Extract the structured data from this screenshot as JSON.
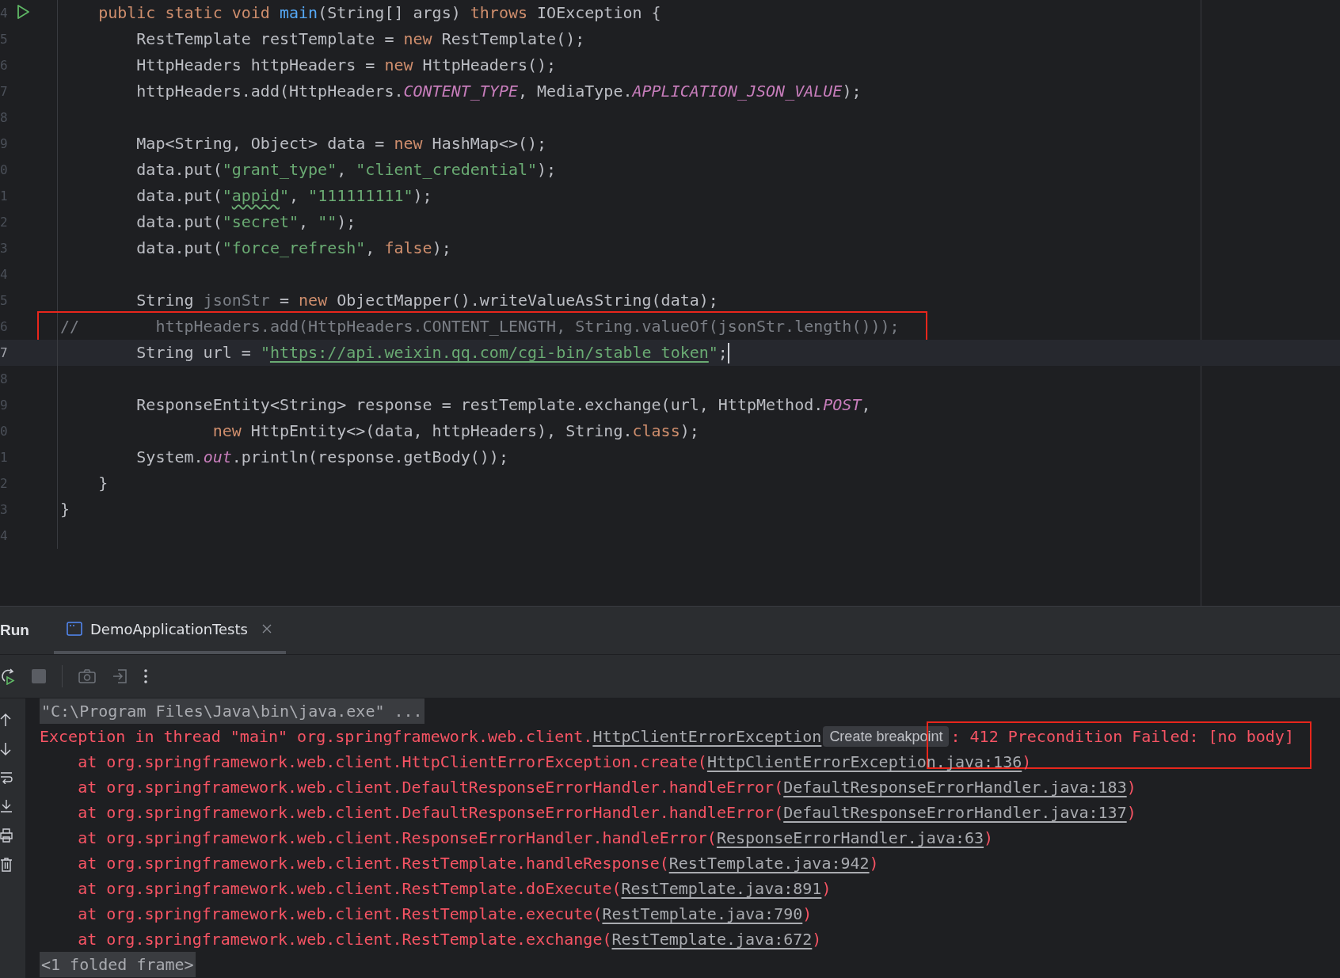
{
  "editor": {
    "lines": [
      {
        "number": "4",
        "run": true,
        "tokens": [
          {
            "text": "    public static void ",
            "kind": "keyword"
          },
          {
            "text": "main",
            "kind": "method"
          },
          {
            "text": "(String[] args) ",
            "kind": "plain"
          },
          {
            "text": "throws",
            "kind": "keyword"
          },
          {
            "text": " IOException {",
            "kind": "plain"
          }
        ]
      },
      {
        "number": "5",
        "tokens": [
          {
            "text": "        RestTemplate restTemplate = ",
            "kind": "plain"
          },
          {
            "text": "new",
            "kind": "keyword"
          },
          {
            "text": " RestTemplate();",
            "kind": "plain"
          }
        ]
      },
      {
        "number": "6",
        "tokens": [
          {
            "text": "        HttpHeaders httpHeaders = ",
            "kind": "plain"
          },
          {
            "text": "new",
            "kind": "keyword"
          },
          {
            "text": " HttpHeaders();",
            "kind": "plain"
          }
        ]
      },
      {
        "number": "7",
        "tokens": [
          {
            "text": "        httpHeaders.add(HttpHeaders.",
            "kind": "plain"
          },
          {
            "text": "CONTENT_TYPE",
            "kind": "field"
          },
          {
            "text": ", MediaType.",
            "kind": "plain"
          },
          {
            "text": "APPLICATION_JSON_VALUE",
            "kind": "field"
          },
          {
            "text": ");",
            "kind": "plain"
          }
        ]
      },
      {
        "number": "8"
      },
      {
        "number": "9",
        "tokens": [
          {
            "text": "        Map<String, Object> data = ",
            "kind": "plain"
          },
          {
            "text": "new",
            "kind": "keyword"
          },
          {
            "text": " HashMap<>();",
            "kind": "plain"
          }
        ]
      },
      {
        "number": "0",
        "tokens": [
          {
            "text": "        data.put(",
            "kind": "plain"
          },
          {
            "text": "\"grant_type\"",
            "kind": "string"
          },
          {
            "text": ", ",
            "kind": "plain"
          },
          {
            "text": "\"client_credential\"",
            "kind": "string"
          },
          {
            "text": ");",
            "kind": "plain"
          }
        ]
      },
      {
        "number": "1",
        "tokens": [
          {
            "text": "        data.put(",
            "kind": "plain"
          },
          {
            "text": "\"",
            "kind": "string"
          },
          {
            "text": "appid",
            "kind": "typo"
          },
          {
            "text": "\"",
            "kind": "string"
          },
          {
            "text": ", ",
            "kind": "plain"
          },
          {
            "text": "\"111111111\"",
            "kind": "string"
          },
          {
            "text": ");",
            "kind": "plain"
          }
        ]
      },
      {
        "number": "2",
        "tokens": [
          {
            "text": "        data.put(",
            "kind": "plain"
          },
          {
            "text": "\"secret\"",
            "kind": "string"
          },
          {
            "text": ", ",
            "kind": "plain"
          },
          {
            "text": "\"\"",
            "kind": "string"
          },
          {
            "text": ");",
            "kind": "plain"
          }
        ]
      },
      {
        "number": "3",
        "tokens": [
          {
            "text": "        data.put(",
            "kind": "plain"
          },
          {
            "text": "\"force_refresh\"",
            "kind": "string"
          },
          {
            "text": ", ",
            "kind": "plain"
          },
          {
            "text": "false",
            "kind": "keyword"
          },
          {
            "text": ");",
            "kind": "plain"
          }
        ]
      },
      {
        "number": "4"
      },
      {
        "number": "5",
        "tokens": [
          {
            "text": "        String ",
            "kind": "plain"
          },
          {
            "text": "jsonStr",
            "kind": "unused"
          },
          {
            "text": " = ",
            "kind": "plain"
          },
          {
            "text": "new",
            "kind": "keyword"
          },
          {
            "text": " ObjectMapper().writeValueAsString(data);",
            "kind": "plain"
          }
        ]
      },
      {
        "number": "6",
        "marked": true,
        "tokens": [
          {
            "text": "//        httpHeaders.add(HttpHeaders.CONTENT_LENGTH, String.valueOf(jsonStr.length()));",
            "kind": "comment"
          }
        ]
      },
      {
        "number": "7",
        "current": true,
        "tokens": [
          {
            "text": "        String url = ",
            "kind": "plain"
          },
          {
            "text": "\"",
            "kind": "string"
          },
          {
            "text": "https://api.weixin.qq.com/cgi-bin/stable_token",
            "kind": "link"
          },
          {
            "text": "\"",
            "kind": "string"
          },
          {
            "text": ";",
            "kind": "plain"
          }
        ]
      },
      {
        "number": "8"
      },
      {
        "number": "9",
        "tokens": [
          {
            "text": "        ResponseEntity<String> response = restTemplate.exchange(url, HttpMethod.",
            "kind": "plain"
          },
          {
            "text": "POST",
            "kind": "field"
          },
          {
            "text": ",",
            "kind": "plain"
          }
        ]
      },
      {
        "number": "0",
        "tokens": [
          {
            "text": "                new",
            "kind": "keyword"
          },
          {
            "text": " HttpEntity<>(data, httpHeaders), String.",
            "kind": "plain"
          },
          {
            "text": "class",
            "kind": "keyword"
          },
          {
            "text": ");",
            "kind": "plain"
          }
        ]
      },
      {
        "number": "1",
        "tokens": [
          {
            "text": "        System.",
            "kind": "plain"
          },
          {
            "text": "out",
            "kind": "field"
          },
          {
            "text": ".println(response.getBody());",
            "kind": "plain"
          }
        ]
      },
      {
        "number": "2",
        "tokens": [
          {
            "text": "    }",
            "kind": "plain"
          }
        ]
      },
      {
        "number": "3",
        "tokens": [
          {
            "text": "}",
            "kind": "plain"
          }
        ]
      },
      {
        "number": "4"
      }
    ]
  },
  "run_panel": {
    "title": "Run",
    "tabs": [
      {
        "label": "DemoApplicationTests",
        "selected": true
      }
    ],
    "console": [
      {
        "tokens": [
          {
            "text": "\"C:\\Program Files\\Java\\bin\\java.exe\" ...",
            "kind": "command"
          }
        ]
      },
      {
        "tokens": [
          {
            "text": "Exception in thread \"main\" org.springframework.web.client.",
            "kind": "error"
          },
          {
            "text": "HttpClientErrorException",
            "kind": "link"
          },
          {
            "text": "Create breakpoint",
            "kind": "tooltip"
          },
          {
            "text": ": 412 Precondition Failed: [no body]",
            "kind": "error",
            "marked": true
          }
        ]
      },
      {
        "tokens": [
          {
            "text": "    at org.springframework.web.client.HttpClientErrorException.create(",
            "kind": "error"
          },
          {
            "text": "HttpClientErrorException.java:136",
            "kind": "link"
          },
          {
            "text": ")",
            "kind": "error"
          }
        ]
      },
      {
        "tokens": [
          {
            "text": "    at org.springframework.web.client.DefaultResponseErrorHandler.handleError(",
            "kind": "error"
          },
          {
            "text": "DefaultResponseErrorHandler.java:183",
            "kind": "link"
          },
          {
            "text": ")",
            "kind": "error"
          }
        ]
      },
      {
        "tokens": [
          {
            "text": "    at org.springframework.web.client.DefaultResponseErrorHandler.handleError(",
            "kind": "error"
          },
          {
            "text": "DefaultResponseErrorHandler.java:137",
            "kind": "link"
          },
          {
            "text": ")",
            "kind": "error"
          }
        ]
      },
      {
        "tokens": [
          {
            "text": "    at org.springframework.web.client.ResponseErrorHandler.handleError(",
            "kind": "error"
          },
          {
            "text": "ResponseErrorHandler.java:63",
            "kind": "link"
          },
          {
            "text": ")",
            "kind": "error"
          }
        ]
      },
      {
        "tokens": [
          {
            "text": "    at org.springframework.web.client.RestTemplate.handleResponse(",
            "kind": "error"
          },
          {
            "text": "RestTemplate.java:942",
            "kind": "link"
          },
          {
            "text": ")",
            "kind": "error"
          }
        ]
      },
      {
        "tokens": [
          {
            "text": "    at org.springframework.web.client.RestTemplate.doExecute(",
            "kind": "error"
          },
          {
            "text": "RestTemplate.java:891",
            "kind": "link"
          },
          {
            "text": ")",
            "kind": "error"
          }
        ]
      },
      {
        "tokens": [
          {
            "text": "    at org.springframework.web.client.RestTemplate.execute(",
            "kind": "error"
          },
          {
            "text": "RestTemplate.java:790",
            "kind": "link"
          },
          {
            "text": ")",
            "kind": "error"
          }
        ]
      },
      {
        "tokens": [
          {
            "text": "    at org.springframework.web.client.RestTemplate.exchange(",
            "kind": "error"
          },
          {
            "text": "RestTemplate.java:672",
            "kind": "link"
          },
          {
            "text": ")",
            "kind": "error"
          }
        ]
      },
      {
        "tokens": [
          {
            "text": "<1 folded frame>",
            "kind": "folded"
          }
        ]
      }
    ]
  }
}
